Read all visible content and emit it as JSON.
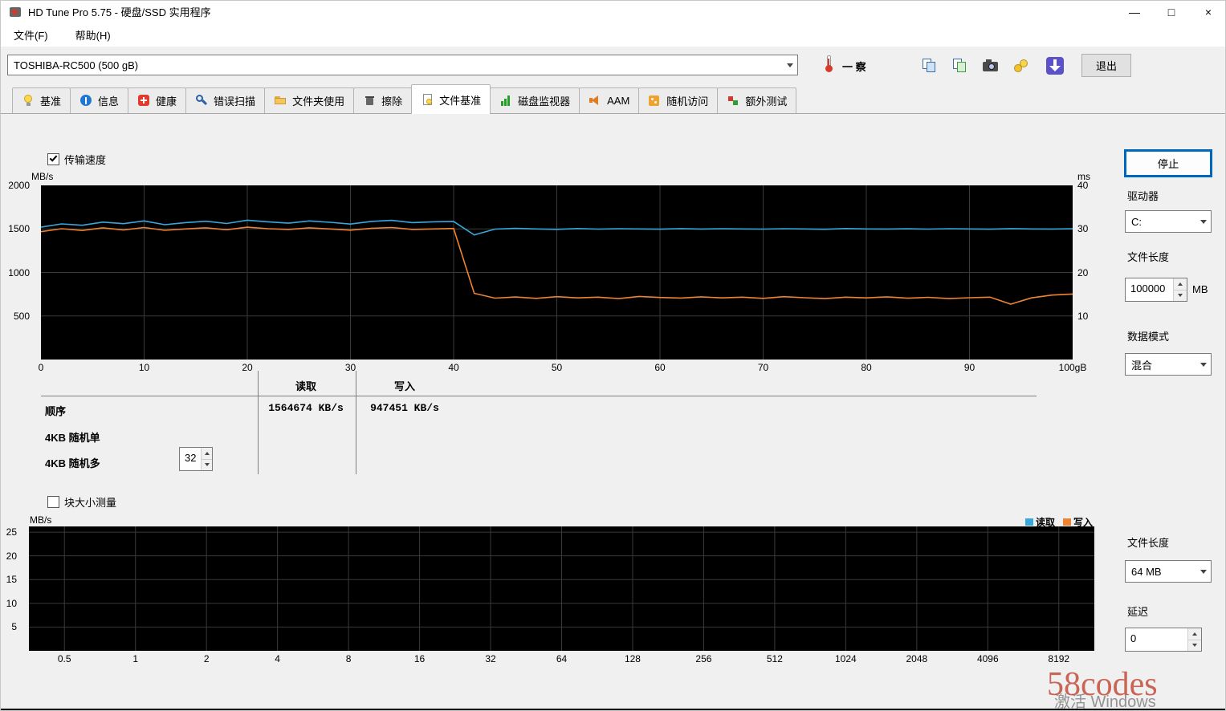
{
  "titlebar": {
    "title": "HD Tune Pro 5.75 - 硬盘/SSD 实用程序",
    "minimize_glyph": "—",
    "maximize_glyph": "□",
    "close_glyph": "×"
  },
  "menu": {
    "file": "文件(F)",
    "help": "帮助(H)"
  },
  "toolbar": {
    "drive_select": "TOSHIBA-RC500 (500 gB)",
    "temperature": "一 察",
    "exit": "退出"
  },
  "tabs": [
    {
      "label": "基准"
    },
    {
      "label": "信息"
    },
    {
      "label": "健康"
    },
    {
      "label": "错误扫描"
    },
    {
      "label": "文件夹使用"
    },
    {
      "label": "擦除"
    },
    {
      "label": "文件基准",
      "active": true
    },
    {
      "label": "磁盘监视器"
    },
    {
      "label": "AAM"
    },
    {
      "label": "随机访问"
    },
    {
      "label": "额外测试"
    }
  ],
  "file_benchmark": {
    "transfer_speed_label": "传输速度",
    "transfer_speed_checked": true,
    "stop_button": "停止",
    "drive_label": "驱动器",
    "drive_value": "C:",
    "file_length_label": "文件长度",
    "file_length_value": "100000",
    "file_length_unit": "MB",
    "data_mode_label": "数据模式",
    "data_mode_value": "混合",
    "results": {
      "read_header": "读取",
      "write_header": "写入",
      "rows": [
        {
          "label": "顺序",
          "read": "1564674 KB/s",
          "write": "947451 KB/s"
        },
        {
          "label": "4KB 随机单",
          "read": "",
          "write": ""
        },
        {
          "label": "4KB 随机多",
          "read": "",
          "write": "",
          "queue_depth": "32"
        }
      ]
    }
  },
  "block_size": {
    "label": "块大小测量",
    "checked": false,
    "legend_read": "读取",
    "legend_write": "写入",
    "file_length_label": "文件长度",
    "file_length_value": "64 MB",
    "latency_label": "延迟",
    "latency_value": "0"
  },
  "watermarks": {
    "site": "58codes",
    "activate": "激活 Windows"
  },
  "chart_data": [
    {
      "type": "line",
      "name": "file-benchmark-transfer-speed",
      "title": "传输速度",
      "ylabel_left": "MB/s",
      "ylabel_right": "ms",
      "ylim_left": [
        0,
        2000
      ],
      "yticks_left": [
        500,
        1000,
        1500,
        2000
      ],
      "ylim_right": [
        0,
        40
      ],
      "yticks_right": [
        10,
        20,
        30,
        40
      ],
      "xlim": [
        0,
        100
      ],
      "xticks": [
        0,
        10,
        20,
        30,
        40,
        50,
        60,
        70,
        80,
        90,
        100
      ],
      "xticklabels": [
        "0",
        "10",
        "20",
        "30",
        "40",
        "50",
        "60",
        "70",
        "80",
        "90",
        "100gB"
      ],
      "grid": true,
      "bg": "#000000",
      "grid_color": "#3a3a3a",
      "x": [
        0,
        2,
        4,
        6,
        8,
        10,
        12,
        14,
        16,
        18,
        20,
        22,
        24,
        26,
        28,
        30,
        32,
        34,
        36,
        38,
        40,
        42,
        44,
        46,
        48,
        50,
        52,
        54,
        56,
        58,
        60,
        62,
        64,
        66,
        68,
        70,
        72,
        74,
        76,
        78,
        80,
        82,
        84,
        86,
        88,
        90,
        92,
        94,
        96,
        98,
        100
      ],
      "series": [
        {
          "name": "读取",
          "color": "#38a8dc",
          "values": [
            1520,
            1558,
            1542,
            1578,
            1560,
            1592,
            1548,
            1572,
            1588,
            1562,
            1600,
            1582,
            1566,
            1592,
            1576,
            1556,
            1586,
            1598,
            1572,
            1582,
            1586,
            1430,
            1498,
            1506,
            1500,
            1495,
            1504,
            1498,
            1502,
            1500,
            1497,
            1503,
            1499,
            1501,
            1500,
            1498,
            1502,
            1500,
            1496,
            1504,
            1500,
            1499,
            1501,
            1498,
            1502,
            1500,
            1497,
            1503,
            1500,
            1499,
            1501
          ]
        },
        {
          "name": "写入",
          "color": "#ee8432",
          "values": [
            1468,
            1502,
            1482,
            1512,
            1488,
            1516,
            1484,
            1500,
            1512,
            1490,
            1520,
            1502,
            1494,
            1512,
            1500,
            1486,
            1506,
            1516,
            1494,
            1500,
            1505,
            760,
            705,
            718,
            702,
            722,
            708,
            716,
            700,
            724,
            712,
            706,
            720,
            708,
            716,
            702,
            722,
            710,
            700,
            716,
            708,
            720,
            704,
            714,
            700,
            710,
            716,
            636,
            708,
            740,
            752
          ]
        }
      ]
    },
    {
      "type": "line",
      "name": "block-size-measurement",
      "title": "块大小测量",
      "ylabel_left": "MB/s",
      "ylim_left": [
        0,
        26.2
      ],
      "yticks_left": [
        5,
        10,
        15,
        20,
        25
      ],
      "xticklabels": [
        "0.5",
        "1",
        "2",
        "4",
        "8",
        "16",
        "32",
        "64",
        "128",
        "256",
        "512",
        "1024",
        "2048",
        "4096",
        "8192"
      ],
      "grid": true,
      "bg": "#000000",
      "grid_color": "#3a3a3a",
      "series": [
        {
          "name": "读取",
          "color": "#38a8dc",
          "values": []
        },
        {
          "name": "写入",
          "color": "#ee8432",
          "values": []
        }
      ]
    }
  ]
}
